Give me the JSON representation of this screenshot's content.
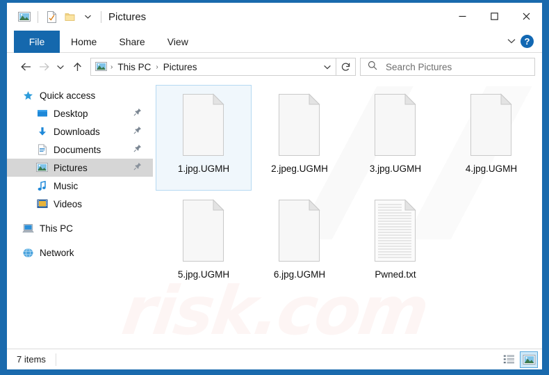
{
  "window": {
    "title": "Pictures",
    "quick_access_toolbar": [
      {
        "name": "pictures-folder-icon",
        "label": "Pictures"
      },
      {
        "name": "properties-icon",
        "label": "Properties"
      },
      {
        "name": "new-folder-icon",
        "label": "New folder"
      },
      {
        "name": "customize-chevron-icon",
        "label": "Customize Quick Access Toolbar"
      }
    ],
    "controls": {
      "minimize": "—",
      "maximize": "☐",
      "close": "✕"
    }
  },
  "ribbon": {
    "tabs": [
      {
        "label": "File",
        "active_style": "file"
      },
      {
        "label": "Home",
        "active_style": "normal"
      },
      {
        "label": "Share",
        "active_style": "normal"
      },
      {
        "label": "View",
        "active_style": "normal"
      }
    ],
    "expand_label": "∨",
    "help_label": "?"
  },
  "navigation": {
    "back": "←",
    "forward": "→",
    "recent": "∨",
    "up": "↑",
    "refresh": "↻",
    "address_dropdown": "∨",
    "breadcrumbs": [
      {
        "label": "This PC"
      },
      {
        "label": "Pictures"
      }
    ],
    "separator": "›"
  },
  "search": {
    "placeholder": "Search Pictures",
    "value": ""
  },
  "sidebar": {
    "items": [
      {
        "label": "Quick access",
        "icon": "star-icon",
        "indent": false,
        "pinned": false,
        "selected": false
      },
      {
        "label": "Desktop",
        "icon": "desktop-icon",
        "indent": true,
        "pinned": true,
        "selected": false
      },
      {
        "label": "Downloads",
        "icon": "downloads-icon",
        "indent": true,
        "pinned": true,
        "selected": false
      },
      {
        "label": "Documents",
        "icon": "documents-icon",
        "indent": true,
        "pinned": true,
        "selected": false
      },
      {
        "label": "Pictures",
        "icon": "pictures-icon",
        "indent": true,
        "pinned": true,
        "selected": true
      },
      {
        "label": "Music",
        "icon": "music-icon",
        "indent": true,
        "pinned": false,
        "selected": false
      },
      {
        "label": "Videos",
        "icon": "videos-icon",
        "indent": true,
        "pinned": false,
        "selected": false
      },
      {
        "label": "This PC",
        "icon": "this-pc-icon",
        "indent": false,
        "pinned": false,
        "selected": false
      },
      {
        "label": "Network",
        "icon": "network-icon",
        "indent": false,
        "pinned": false,
        "selected": false
      }
    ]
  },
  "files": {
    "items": [
      {
        "name": "1.jpg.UGMH",
        "icon": "blank-file-icon",
        "selected": true
      },
      {
        "name": "2.jpeg.UGMH",
        "icon": "blank-file-icon",
        "selected": false
      },
      {
        "name": "3.jpg.UGMH",
        "icon": "blank-file-icon",
        "selected": false
      },
      {
        "name": "4.jpg.UGMH",
        "icon": "blank-file-icon",
        "selected": false
      },
      {
        "name": "5.jpg.UGMH",
        "icon": "blank-file-icon",
        "selected": false
      },
      {
        "name": "6.jpg.UGMH",
        "icon": "blank-file-icon",
        "selected": false
      },
      {
        "name": "Pwned.txt",
        "icon": "text-file-icon",
        "selected": false
      }
    ]
  },
  "statusbar": {
    "item_count": "7 items",
    "views": [
      {
        "name": "details-view-button",
        "label": "Details view",
        "active": false
      },
      {
        "name": "large-icons-view-button",
        "label": "Large icons view",
        "active": true
      }
    ]
  },
  "watermark": {
    "text": "risk.com"
  },
  "colors": {
    "window_frame": "#1a6aad",
    "file_tab": "#1568ad",
    "selection_border": "#b5d9f2",
    "sidebar_selected": "#d6d6d6",
    "accent": "#1268b3"
  }
}
